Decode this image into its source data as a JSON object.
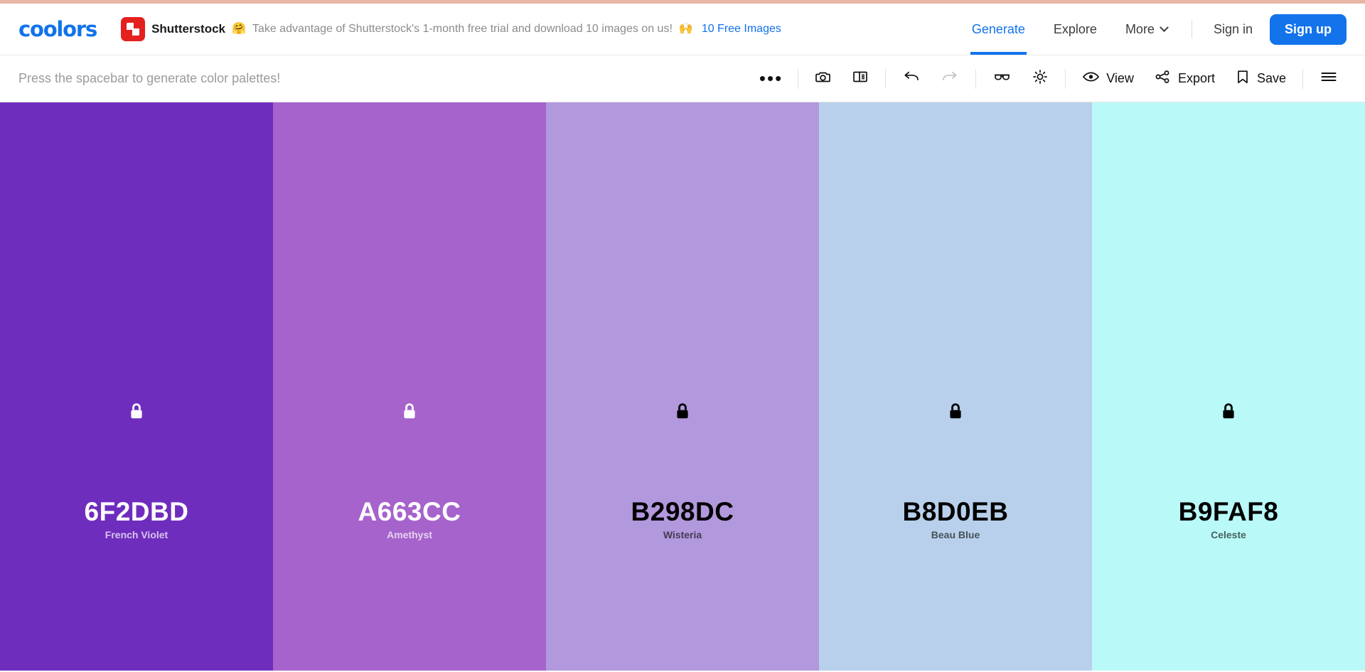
{
  "theme": {
    "accent": "#1273eb",
    "top_strip": "#e8b6a6",
    "shutterstock_red": "#e3211e"
  },
  "header": {
    "logo": "coolors",
    "promo": {
      "brand": "Shutterstock",
      "brand_emoji": "🤗",
      "text": "Take advantage of Shutterstock's 1-month free trial and download 10 images on us!",
      "link_emoji": "🙌",
      "link": "10 Free Images"
    },
    "nav": [
      {
        "label": "Generate",
        "active": true
      },
      {
        "label": "Explore",
        "active": false
      },
      {
        "label": "More",
        "active": false,
        "has_chevron": true
      }
    ],
    "sign_in": "Sign in",
    "sign_up": "Sign up"
  },
  "toolbar": {
    "hint": "Press the spacebar to generate color palettes!",
    "more_dots": "•••",
    "items": [
      {
        "icon": "camera-icon",
        "label": "",
        "disabled": false
      },
      {
        "icon": "layout-icon",
        "label": "",
        "disabled": false
      },
      {
        "icon": "undo-icon",
        "label": "",
        "disabled": false
      },
      {
        "icon": "redo-icon",
        "label": "",
        "disabled": true
      },
      {
        "icon": "glasses-icon",
        "label": "",
        "disabled": false
      },
      {
        "icon": "brightness-icon",
        "label": "",
        "disabled": false
      },
      {
        "icon": "eye-icon",
        "label": "View",
        "disabled": false
      },
      {
        "icon": "share-icon",
        "label": "Export",
        "disabled": false
      },
      {
        "icon": "bookmark-icon",
        "label": "Save",
        "disabled": false
      },
      {
        "icon": "hamburger-icon",
        "label": "",
        "disabled": false
      }
    ],
    "view_label": "View",
    "export_label": "Export",
    "save_label": "Save"
  },
  "palette": {
    "swatches": [
      {
        "hex": "6F2DBD",
        "color": "#6F2DBD",
        "name": "French Violet",
        "text": "light",
        "locked": true
      },
      {
        "hex": "A663CC",
        "color": "#A663CC",
        "name": "Amethyst",
        "text": "light",
        "locked": true
      },
      {
        "hex": "B298DC",
        "color": "#B298DC",
        "name": "Wisteria",
        "text": "dark",
        "locked": true
      },
      {
        "hex": "B8D0EB",
        "color": "#B8D0EB",
        "name": "Beau Blue",
        "text": "dark",
        "locked": true
      },
      {
        "hex": "B9FAF8",
        "color": "#B9FAF8",
        "name": "Celeste",
        "text": "dark",
        "locked": true
      }
    ]
  }
}
